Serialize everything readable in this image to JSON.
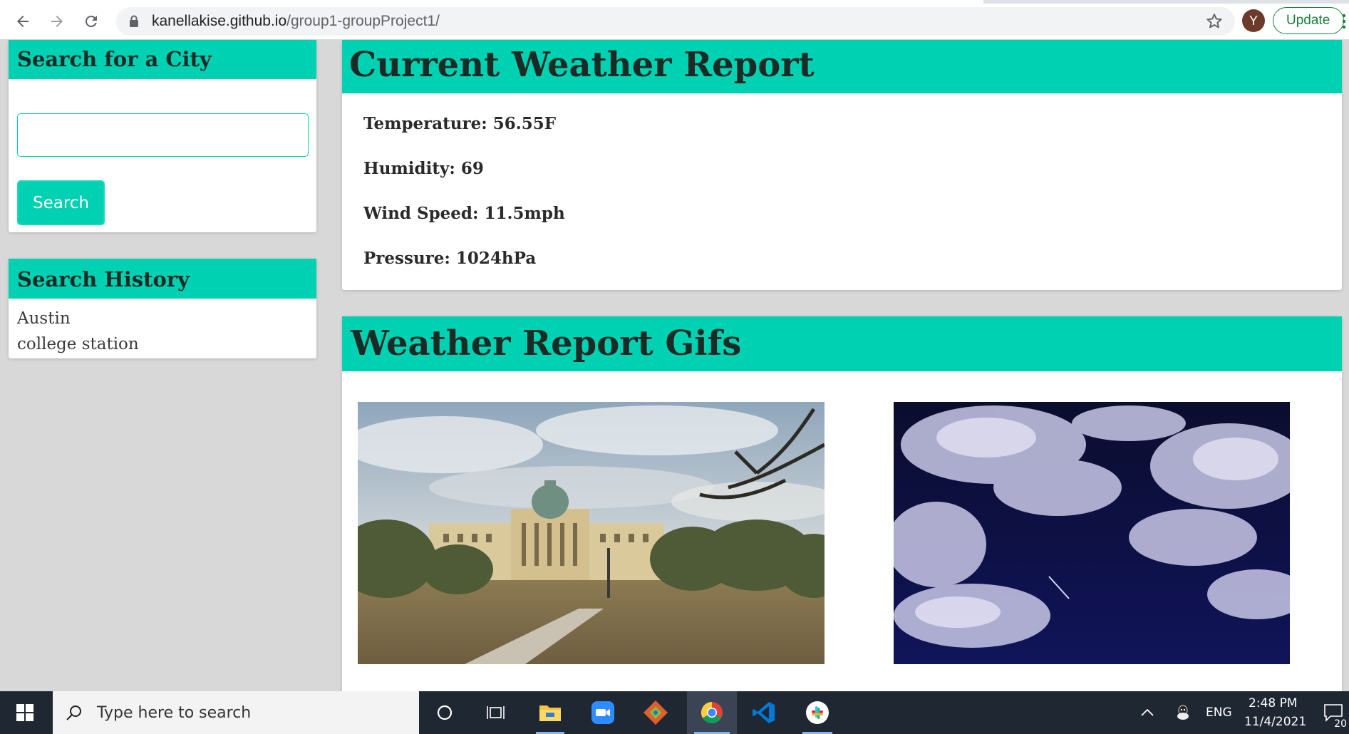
{
  "browser": {
    "url_host": "kanellakise.github.io",
    "url_path": "/group1-groupProject1/",
    "avatar_initial": "Y",
    "update_label": "Update"
  },
  "search_panel": {
    "title": "Search for a City",
    "input_value": "",
    "button_label": "Search"
  },
  "history_panel": {
    "title": "Search History",
    "items": [
      "Austin",
      "college station"
    ]
  },
  "report_panel": {
    "title": "Current Weather Report",
    "temperature": "Temperature: 56.55F",
    "humidity": "Humidity: 69",
    "wind": "Wind Speed: 11.5mph",
    "pressure": "Pressure: 1024hPa"
  },
  "gifs_panel": {
    "title": "Weather Report Gifs"
  },
  "taskbar": {
    "search_placeholder": "Type here to search",
    "language": "ENG",
    "time": "2:48 PM",
    "date": "11/4/2021",
    "notification_count": "20"
  },
  "colors": {
    "accent": "#00d1b2",
    "taskbar": "#1f2733"
  },
  "icons": [
    "back-icon",
    "forward-icon",
    "reload-icon",
    "lock-icon",
    "star-icon",
    "more-icon",
    "windows-icon",
    "search-icon",
    "cortana-icon",
    "task-view-icon",
    "file-explorer-icon",
    "zoom-icon",
    "git-icon",
    "chrome-icon",
    "vscode-icon",
    "slack-icon",
    "chevron-up-icon",
    "tray-app-icon",
    "notification-icon"
  ]
}
